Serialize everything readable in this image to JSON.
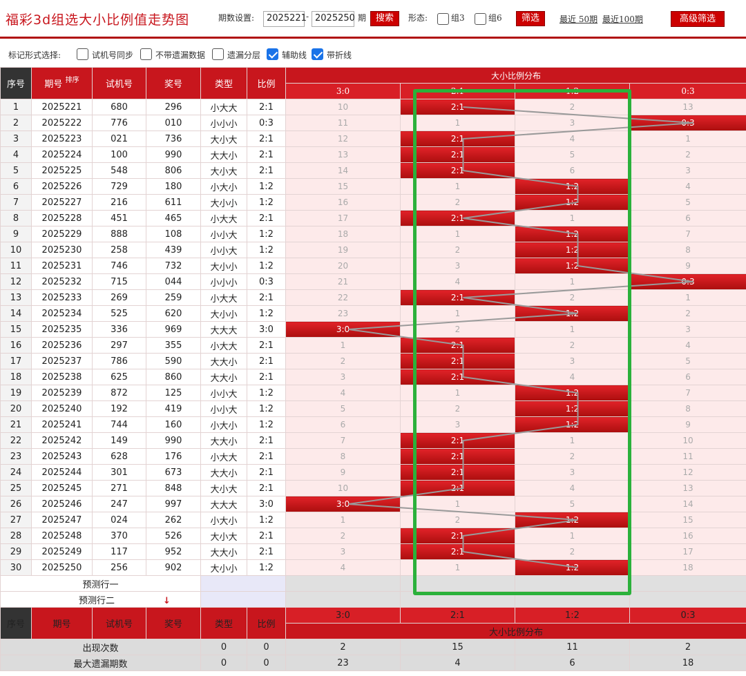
{
  "title": "福彩3d组选大小比例值走势图",
  "toolbar": {
    "period_label": "期数设置:",
    "from": "2025221",
    "dash": "-",
    "to": "2025250",
    "period_unit": "期",
    "search": "搜索",
    "shape_label": "形态:",
    "zu3": "组3",
    "zu6": "组6",
    "filter": "筛选",
    "recent50": "最近 50期",
    "recent100": "最近100期",
    "advanced": "高级筛选"
  },
  "markbar": {
    "label": "标记形式选择:",
    "opt1": "试机号同步",
    "opt2": "不带遗漏数据",
    "opt3": "遗漏分层",
    "opt4": "辅助线",
    "opt5": "带折线",
    "checked": [
      false,
      false,
      false,
      true,
      true
    ]
  },
  "headers": {
    "seq": "序号",
    "period": "期号",
    "sort": "排序",
    "trial": "试机号",
    "prize": "奖号",
    "type": "类型",
    "ratio": "比例",
    "dist": "大小比例分布",
    "cols": [
      "3:0",
      "2:1",
      "1:2",
      "0:3"
    ]
  },
  "rows": [
    {
      "seq": "1",
      "period": "2025221",
      "trial": "680",
      "prize": "296",
      "type": "小大大",
      "ratio": "2:1",
      "cells": [
        "10",
        "2:1",
        "2",
        "13"
      ],
      "hit": 1
    },
    {
      "seq": "2",
      "period": "2025222",
      "trial": "776",
      "prize": "010",
      "type": "小小小",
      "ratio": "0:3",
      "cells": [
        "11",
        "1",
        "3",
        "0:3"
      ],
      "hit": 3
    },
    {
      "seq": "3",
      "period": "2025223",
      "trial": "021",
      "prize": "736",
      "type": "大小大",
      "ratio": "2:1",
      "cells": [
        "12",
        "2:1",
        "4",
        "1"
      ],
      "hit": 1
    },
    {
      "seq": "4",
      "period": "2025224",
      "trial": "100",
      "prize": "990",
      "type": "大大小",
      "ratio": "2:1",
      "cells": [
        "13",
        "2:1",
        "5",
        "2"
      ],
      "hit": 1
    },
    {
      "seq": "5",
      "period": "2025225",
      "trial": "548",
      "prize": "806",
      "type": "大小大",
      "ratio": "2:1",
      "cells": [
        "14",
        "2:1",
        "6",
        "3"
      ],
      "hit": 1
    },
    {
      "seq": "6",
      "period": "2025226",
      "trial": "729",
      "prize": "180",
      "type": "小大小",
      "ratio": "1:2",
      "cells": [
        "15",
        "1",
        "1:2",
        "4"
      ],
      "hit": 2
    },
    {
      "seq": "7",
      "period": "2025227",
      "trial": "216",
      "prize": "611",
      "type": "大小小",
      "ratio": "1:2",
      "cells": [
        "16",
        "2",
        "1:2",
        "5"
      ],
      "hit": 2
    },
    {
      "seq": "8",
      "period": "2025228",
      "trial": "451",
      "prize": "465",
      "type": "小大大",
      "ratio": "2:1",
      "cells": [
        "17",
        "2:1",
        "1",
        "6"
      ],
      "hit": 1
    },
    {
      "seq": "9",
      "period": "2025229",
      "trial": "888",
      "prize": "108",
      "type": "小小大",
      "ratio": "1:2",
      "cells": [
        "18",
        "1",
        "1:2",
        "7"
      ],
      "hit": 2
    },
    {
      "seq": "10",
      "period": "2025230",
      "trial": "258",
      "prize": "439",
      "type": "小小大",
      "ratio": "1:2",
      "cells": [
        "19",
        "2",
        "1:2",
        "8"
      ],
      "hit": 2
    },
    {
      "seq": "11",
      "period": "2025231",
      "trial": "746",
      "prize": "732",
      "type": "大小小",
      "ratio": "1:2",
      "cells": [
        "20",
        "3",
        "1:2",
        "9"
      ],
      "hit": 2
    },
    {
      "seq": "12",
      "period": "2025232",
      "trial": "715",
      "prize": "044",
      "type": "小小小",
      "ratio": "0:3",
      "cells": [
        "21",
        "4",
        "1",
        "0:3"
      ],
      "hit": 3
    },
    {
      "seq": "13",
      "period": "2025233",
      "trial": "269",
      "prize": "259",
      "type": "小大大",
      "ratio": "2:1",
      "cells": [
        "22",
        "2:1",
        "2",
        "1"
      ],
      "hit": 1
    },
    {
      "seq": "14",
      "period": "2025234",
      "trial": "525",
      "prize": "620",
      "type": "大小小",
      "ratio": "1:2",
      "cells": [
        "23",
        "1",
        "1:2",
        "2"
      ],
      "hit": 2
    },
    {
      "seq": "15",
      "period": "2025235",
      "trial": "336",
      "prize": "969",
      "type": "大大大",
      "ratio": "3:0",
      "cells": [
        "3:0",
        "2",
        "1",
        "3"
      ],
      "hit": 0
    },
    {
      "seq": "16",
      "period": "2025236",
      "trial": "297",
      "prize": "355",
      "type": "小大大",
      "ratio": "2:1",
      "cells": [
        "1",
        "2:1",
        "2",
        "4"
      ],
      "hit": 1
    },
    {
      "seq": "17",
      "period": "2025237",
      "trial": "786",
      "prize": "590",
      "type": "大大小",
      "ratio": "2:1",
      "cells": [
        "2",
        "2:1",
        "3",
        "5"
      ],
      "hit": 1
    },
    {
      "seq": "18",
      "period": "2025238",
      "trial": "625",
      "prize": "860",
      "type": "大大小",
      "ratio": "2:1",
      "cells": [
        "3",
        "2:1",
        "4",
        "6"
      ],
      "hit": 1
    },
    {
      "seq": "19",
      "period": "2025239",
      "trial": "872",
      "prize": "125",
      "type": "小小大",
      "ratio": "1:2",
      "cells": [
        "4",
        "1",
        "1:2",
        "7"
      ],
      "hit": 2
    },
    {
      "seq": "20",
      "period": "2025240",
      "trial": "192",
      "prize": "419",
      "type": "小小大",
      "ratio": "1:2",
      "cells": [
        "5",
        "2",
        "1:2",
        "8"
      ],
      "hit": 2
    },
    {
      "seq": "21",
      "period": "2025241",
      "trial": "744",
      "prize": "160",
      "type": "小大小",
      "ratio": "1:2",
      "cells": [
        "6",
        "3",
        "1:2",
        "9"
      ],
      "hit": 2
    },
    {
      "seq": "22",
      "period": "2025242",
      "trial": "149",
      "prize": "990",
      "type": "大大小",
      "ratio": "2:1",
      "cells": [
        "7",
        "2:1",
        "1",
        "10"
      ],
      "hit": 1
    },
    {
      "seq": "23",
      "period": "2025243",
      "trial": "628",
      "prize": "176",
      "type": "小大大",
      "ratio": "2:1",
      "cells": [
        "8",
        "2:1",
        "2",
        "11"
      ],
      "hit": 1
    },
    {
      "seq": "24",
      "period": "2025244",
      "trial": "301",
      "prize": "673",
      "type": "大大小",
      "ratio": "2:1",
      "cells": [
        "9",
        "2:1",
        "3",
        "12"
      ],
      "hit": 1
    },
    {
      "seq": "25",
      "period": "2025245",
      "trial": "271",
      "prize": "848",
      "type": "大小大",
      "ratio": "2:1",
      "cells": [
        "10",
        "2:1",
        "4",
        "13"
      ],
      "hit": 1
    },
    {
      "seq": "26",
      "period": "2025246",
      "trial": "247",
      "prize": "997",
      "type": "大大大",
      "ratio": "3:0",
      "cells": [
        "3:0",
        "1",
        "5",
        "14"
      ],
      "hit": 0
    },
    {
      "seq": "27",
      "period": "2025247",
      "trial": "024",
      "prize": "262",
      "type": "小大小",
      "ratio": "1:2",
      "cells": [
        "1",
        "2",
        "1:2",
        "15"
      ],
      "hit": 2
    },
    {
      "seq": "28",
      "period": "2025248",
      "trial": "370",
      "prize": "526",
      "type": "大小大",
      "ratio": "2:1",
      "cells": [
        "2",
        "2:1",
        "1",
        "16"
      ],
      "hit": 1
    },
    {
      "seq": "29",
      "period": "2025249",
      "trial": "117",
      "prize": "952",
      "type": "大大小",
      "ratio": "2:1",
      "cells": [
        "3",
        "2:1",
        "2",
        "17"
      ],
      "hit": 1
    },
    {
      "seq": "30",
      "period": "2025250",
      "trial": "256",
      "prize": "902",
      "type": "大小小",
      "ratio": "1:2",
      "cells": [
        "4",
        "1",
        "1:2",
        "18"
      ],
      "hit": 2
    }
  ],
  "predict": {
    "row1": "预测行一",
    "row2": "预测行二",
    "arrow": "↓"
  },
  "stats": [
    {
      "label": "出现次数",
      "type": "0",
      "ratio": "0",
      "cells": [
        "2",
        "15",
        "11",
        "2"
      ]
    },
    {
      "label": "最大遗漏期数",
      "type": "0",
      "ratio": "0",
      "cells": [
        "23",
        "4",
        "6",
        "18"
      ]
    }
  ],
  "colors": {
    "accent": "#c8161d",
    "highlight": "#2bb13b"
  }
}
